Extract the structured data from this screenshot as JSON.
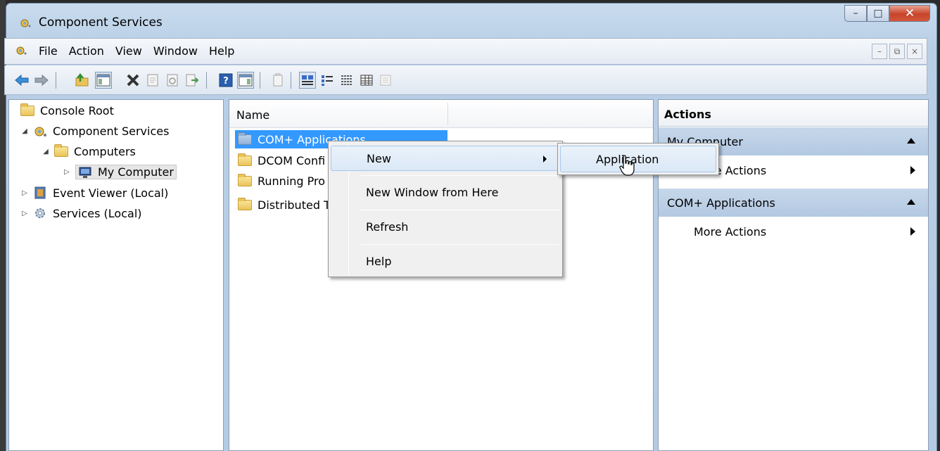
{
  "window": {
    "title": "Component Services",
    "controls": {
      "minimize": "–",
      "maximize": "□",
      "close": "✕"
    }
  },
  "menubar": {
    "items": [
      "File",
      "Action",
      "View",
      "Window",
      "Help"
    ],
    "mdi": {
      "minimize": "–",
      "restore": "⧉",
      "close": "×"
    }
  },
  "toolbar": {
    "buttons": [
      "back-icon",
      "forward-icon",
      "up-folder-icon",
      "show-hide-tree-icon",
      "delete-icon",
      "properties-icon",
      "refresh-icon",
      "export-list-icon",
      "help-icon",
      "show-hide-action-pane-icon",
      "new-window-icon",
      "large-icons-icon",
      "small-icons-icon",
      "list-view-icon",
      "detail-view-icon",
      "configure-icon"
    ]
  },
  "tree": {
    "root": "Console Root",
    "component_services": "Component Services",
    "computers": "Computers",
    "my_computer": "My Computer",
    "event_viewer": "Event Viewer (Local)",
    "services": "Services (Local)"
  },
  "list": {
    "column_name": "Name",
    "items": [
      "COM+ Applications",
      "DCOM Confi",
      "Running Pro",
      "Distributed T"
    ]
  },
  "actions": {
    "header": "Actions",
    "section1": "My Computer",
    "section1_more": "More Actions",
    "section2": "COM+ Applications",
    "section2_more": "More Actions"
  },
  "context_menu": {
    "new": "New",
    "new_window": "New Window from Here",
    "refresh": "Refresh",
    "help": "Help"
  },
  "submenu": {
    "application": "Application"
  }
}
